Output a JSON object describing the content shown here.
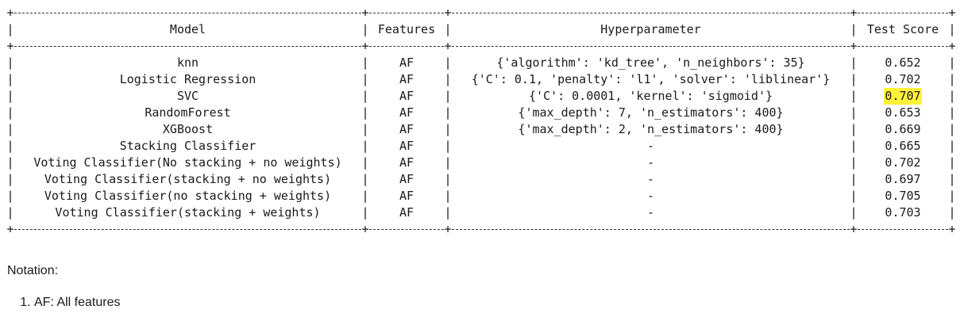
{
  "table": {
    "headers": {
      "model": "Model",
      "features": "Features",
      "hyperparameter": "Hyperparameter",
      "test_score": "Test Score"
    },
    "rows": [
      {
        "model": "knn",
        "features": "AF",
        "hyperparameter": "{'algorithm': 'kd_tree', 'n_neighbors': 35}",
        "test_score": "0.652"
      },
      {
        "model": "Logistic Regression",
        "features": "AF",
        "hyperparameter": "{'C': 0.1, 'penalty': 'l1', 'solver': 'liblinear'}",
        "test_score": "0.702"
      },
      {
        "model": "SVC",
        "features": "AF",
        "hyperparameter": "{'C': 0.0001, 'kernel': 'sigmoid'}",
        "test_score": "0.707"
      },
      {
        "model": "RandomForest",
        "features": "AF",
        "hyperparameter": "{'max_depth': 7, 'n_estimators': 400}",
        "test_score": "0.653"
      },
      {
        "model": "XGBoost",
        "features": "AF",
        "hyperparameter": "{'max_depth': 2, 'n_estimators': 400}",
        "test_score": "0.669"
      },
      {
        "model": "Stacking Classifier",
        "features": "AF",
        "hyperparameter": "-",
        "test_score": "0.665"
      },
      {
        "model": "Voting Classifier(No stacking + no weights)",
        "features": "AF",
        "hyperparameter": "-",
        "test_score": "0.702"
      },
      {
        "model": "Voting Classifier(stacking + no weights)",
        "features": "AF",
        "hyperparameter": "-",
        "test_score": "0.697"
      },
      {
        "model": "Voting Classifier(no stacking + weights)",
        "features": "AF",
        "hyperparameter": "-",
        "test_score": "0.705"
      },
      {
        "model": "Voting Classifier(stacking + weights)",
        "features": "AF",
        "hyperparameter": "-",
        "test_score": "0.703"
      }
    ],
    "highlight_color": "#fff23a"
  },
  "notes": {
    "title": "Notation:",
    "items": [
      "AF: All features"
    ]
  }
}
